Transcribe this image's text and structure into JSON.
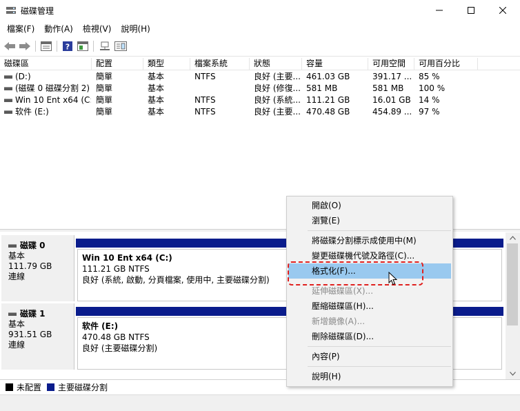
{
  "window": {
    "title": "磁碟管理"
  },
  "menubar": [
    "檔案(F)",
    "動作(A)",
    "檢視(V)",
    "說明(H)"
  ],
  "toolbar": {
    "icons": [
      "back-icon",
      "forward-icon",
      "properties-icon",
      "help-icon",
      "show-pane-icon",
      "connect-icon",
      "settings-icon"
    ]
  },
  "volume_table": {
    "headers": [
      "磁碟區",
      "配置",
      "類型",
      "檔案系統",
      "狀態",
      "容量",
      "可用空間",
      "可用百分比"
    ],
    "rows": [
      [
        "(D:)",
        "簡單",
        "基本",
        "NTFS",
        "良好 (主要...",
        "461.03 GB",
        "391.17 ...",
        "85 %"
      ],
      [
        "(磁碟 0 磁碟分割 2)",
        "簡單",
        "基本",
        "",
        "良好 (修復...",
        "581 MB",
        "581 MB",
        "100 %"
      ],
      [
        "Win 10 Ent x64 (C:)",
        "簡單",
        "基本",
        "NTFS",
        "良好 (系統...",
        "111.21 GB",
        "16.01 GB",
        "14 %"
      ],
      [
        "软件 (E:)",
        "簡單",
        "基本",
        "NTFS",
        "良好 (主要...",
        "470.48 GB",
        "454.89 ...",
        "97 %"
      ]
    ]
  },
  "disks": [
    {
      "name": "磁碟 0",
      "type": "基本",
      "size": "111.79 GB",
      "status": "連線",
      "partition": {
        "name": "Win 10 Ent x64  (C:)",
        "size": "111.21 GB NTFS",
        "status": "良好 (系統, 啟動, 分頁檔案, 使用中, 主要磁碟分割)"
      }
    },
    {
      "name": "磁碟 1",
      "type": "基本",
      "size": "931.51 GB",
      "status": "連線",
      "partition": {
        "name": "软件  (E:)",
        "size": "470.48 GB NTFS",
        "status": "良好 (主要磁碟分割)"
      }
    }
  ],
  "legend": [
    {
      "label": "未配置",
      "color": "#000000"
    },
    {
      "label": "主要磁碟分割",
      "color": "#0a1c8c"
    }
  ],
  "context_menu": {
    "items": [
      {
        "label": "開啟(O)",
        "enabled": true
      },
      {
        "label": "瀏覽(E)",
        "enabled": true
      },
      {
        "label": "將磁碟分割標示成使用中(M)",
        "enabled": true
      },
      {
        "label": "變更磁碟機代號及路徑(C)...",
        "enabled": true
      },
      {
        "label": "格式化(F)...",
        "enabled": true,
        "highlighted": true
      },
      {
        "label": "延伸磁碟區(X)...",
        "enabled": false
      },
      {
        "label": "壓縮磁碟區(H)...",
        "enabled": true
      },
      {
        "label": "新增鏡像(A)...",
        "enabled": false
      },
      {
        "label": "刪除磁碟區(D)...",
        "enabled": true
      },
      {
        "label": "內容(P)",
        "enabled": true
      },
      {
        "label": "說明(H)",
        "enabled": true
      }
    ]
  },
  "colors": {
    "primary_partition": "#0a1c8c",
    "highlight": "#99c9ef",
    "callout": "#e0201e"
  }
}
